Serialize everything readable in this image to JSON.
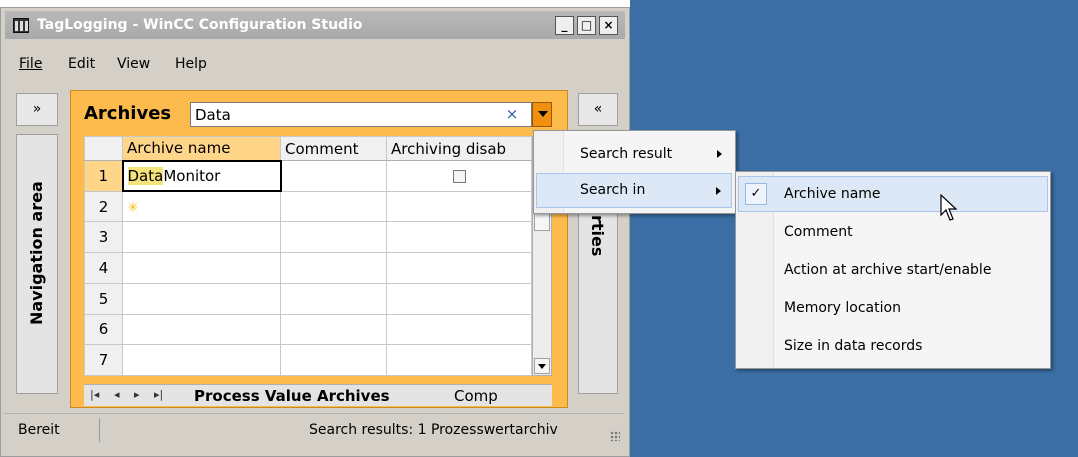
{
  "window": {
    "title": "TagLogging - WinCC Configuration Studio",
    "controls": {
      "minimize": "_",
      "maximize": "□",
      "close": "×"
    }
  },
  "menubar": [
    "File",
    "Edit",
    "View",
    "Help"
  ],
  "navigation": {
    "expand_label": "»",
    "title": "Navigation area"
  },
  "properties": {
    "collapse_label": "«",
    "title_visible_part": "rties"
  },
  "editor": {
    "label": "Archives",
    "search_value": "Data",
    "clear_label": "×"
  },
  "grid": {
    "columns": [
      "Archive name",
      "Comment",
      "Archiving disab"
    ],
    "rows": [
      {
        "num": "1",
        "name_highlight": "Data",
        "name_rest": "Monitor",
        "comment": "",
        "archiving_disabled": false
      },
      {
        "num": "2",
        "name_highlight": "",
        "name_rest": "",
        "comment": "",
        "new_row_icon": "new-row-star-icon"
      },
      {
        "num": "3"
      },
      {
        "num": "4"
      },
      {
        "num": "5"
      },
      {
        "num": "6"
      },
      {
        "num": "7"
      }
    ]
  },
  "tabs": {
    "nav": [
      "|◂",
      "◂",
      "▸",
      "▸|"
    ],
    "active": "Process Value Archives",
    "next": "Comp"
  },
  "status": {
    "left": "Bereit",
    "right": "Search results: 1 Prozesswertarchiv"
  },
  "context_menu": {
    "items": [
      {
        "label": "Search result",
        "has_submenu": true
      },
      {
        "label": "Search in",
        "has_submenu": true,
        "highlighted": true
      }
    ]
  },
  "submenu": {
    "items": [
      {
        "label": "Archive name",
        "checked": true,
        "highlighted": true
      },
      {
        "label": "Comment",
        "checked": false
      },
      {
        "label": "Action at archive start/enable",
        "checked": false
      },
      {
        "label": "Memory location",
        "checked": false
      },
      {
        "label": "Size in data records",
        "checked": false
      }
    ],
    "check_glyph": "✓"
  },
  "colors": {
    "desktop": "#3a6ea5",
    "editor_frame": "#fdba4d",
    "titlebar": "#b0b0b0",
    "menu_highlight": "#dde8f6"
  }
}
